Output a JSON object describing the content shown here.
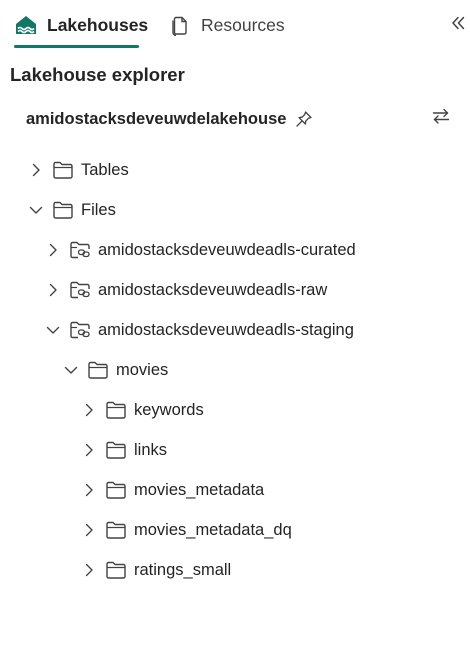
{
  "tabs": [
    {
      "label": "Lakehouses",
      "active": true,
      "icon": "lakehouse-icon"
    },
    {
      "label": "Resources",
      "active": false,
      "icon": "document-icon"
    }
  ],
  "collapse_icon": "double-chevron-left-icon",
  "explorer": {
    "title": "Lakehouse explorer",
    "lakehouse_name": "amidostacksdeveuwdelakehouse",
    "pin_icon": "pin-icon",
    "switch_icon": "swap-arrows-icon"
  },
  "tree": {
    "tables": {
      "label": "Tables",
      "expanded": false
    },
    "files": {
      "label": "Files",
      "expanded": true
    },
    "curated": {
      "label": "amidostacksdeveuwdeadls-curated",
      "expanded": false
    },
    "raw": {
      "label": "amidostacksdeveuwdeadls-raw",
      "expanded": false
    },
    "staging": {
      "label": "amidostacksdeveuwdeadls-staging",
      "expanded": true
    },
    "movies": {
      "label": "movies",
      "expanded": true
    },
    "keywords": {
      "label": "keywords",
      "expanded": false
    },
    "links": {
      "label": "links",
      "expanded": false
    },
    "movies_metadata": {
      "label": "movies_metadata",
      "expanded": false
    },
    "movies_metadata_dq": {
      "label": "movies_metadata_dq",
      "expanded": false
    },
    "ratings_small": {
      "label": "ratings_small",
      "expanded": false
    }
  },
  "colors": {
    "accent": "#117865",
    "text": "#242424",
    "icon": "#424242"
  }
}
